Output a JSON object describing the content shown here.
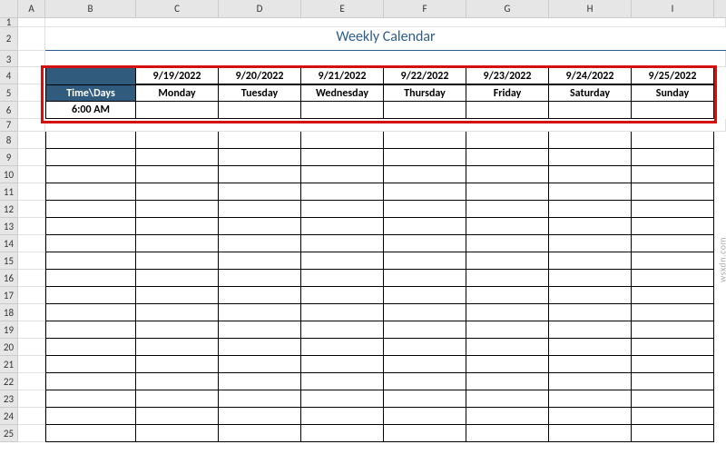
{
  "columns": [
    "",
    "A",
    "B",
    "C",
    "D",
    "E",
    "F",
    "G",
    "H",
    "I"
  ],
  "row_nums": [
    "1",
    "2",
    "3",
    "4",
    "5",
    "6",
    "7",
    "8",
    "9",
    "10",
    "11",
    "12",
    "13",
    "14",
    "15",
    "16",
    "17",
    "18",
    "19",
    "20",
    "21",
    "22",
    "23",
    "24",
    "25"
  ],
  "title": "Weekly Calendar",
  "header_dates": [
    "9/19/2022",
    "9/20/2022",
    "9/21/2022",
    "9/22/2022",
    "9/23/2022",
    "9/24/2022",
    "9/25/2022"
  ],
  "header_days": [
    "Monday",
    "Tuesday",
    "Wednesday",
    "Thursday",
    "Friday",
    "Saturday",
    "Sunday"
  ],
  "time_days_label": "Time\\Days",
  "first_time": "6:00 AM",
  "watermark": "wsxdn.com",
  "chart_data": {
    "type": "table",
    "title": "Weekly Calendar",
    "columns": [
      "Time\\Days",
      "9/19/2022 Monday",
      "9/20/2022 Tuesday",
      "9/21/2022 Wednesday",
      "9/22/2022 Thursday",
      "9/23/2022 Friday",
      "9/24/2022 Saturday",
      "9/25/2022 Sunday"
    ],
    "rows": [
      [
        "6:00 AM",
        "",
        "",
        "",
        "",
        "",
        "",
        ""
      ]
    ]
  }
}
